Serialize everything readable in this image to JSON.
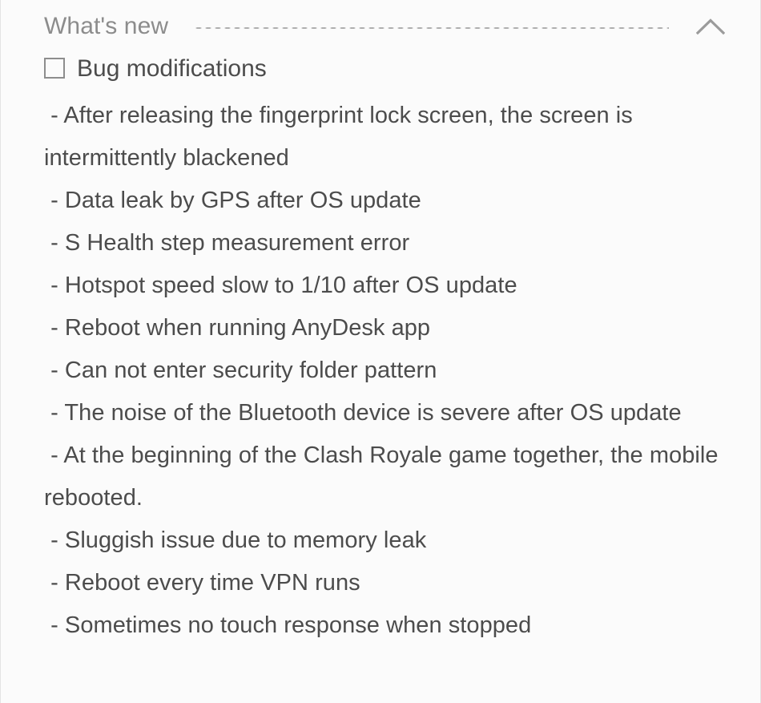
{
  "section": {
    "title": "What's new",
    "collapse_icon": "chevron-up-icon",
    "divider": "dotted-rule",
    "expanded": true
  },
  "changelog": {
    "checkbox_glyph": "unchecked-checkbox-icon",
    "heading": "Bug modifications",
    "items": [
      "- After releasing the fingerprint lock screen, the screen is intermittently blackened",
      "- Data leak by GPS after OS update",
      "- S Health step measurement error",
      "- Hotspot speed slow to 1/10 after OS update",
      "- Reboot when running AnyDesk app",
      "- Can not enter security folder pattern",
      "- The noise of the Bluetooth device is severe after OS update",
      "- At the beginning of the Clash Royale game together, the mobile rebooted.",
      "- Sluggish issue due to memory leak",
      "- Reboot every time VPN runs",
      "- Sometimes no touch response when stopped"
    ],
    "body": " - After releasing the fingerprint lock screen, the screen is intermittently blackened\n - Data leak by GPS after OS update\n - S Health step measurement error\n - Hotspot speed slow to 1/10 after OS update\n - Reboot when running AnyDesk app\n - Can not enter security folder pattern\n - The noise of the Bluetooth device is severe after OS update\n - At the beginning of the Clash Royale game together, the mobile rebooted.\n - Sluggish issue due to memory leak\n - Reboot every time VPN runs\n - Sometimes no touch response when stopped"
  },
  "colors": {
    "page_background": "#fafafa",
    "card_background": "#fbfbfb",
    "title_text": "#8c8c8c",
    "body_text": "#4c4c4c",
    "divider_dots": "#aeaeae",
    "border": "#e4e4e4"
  }
}
